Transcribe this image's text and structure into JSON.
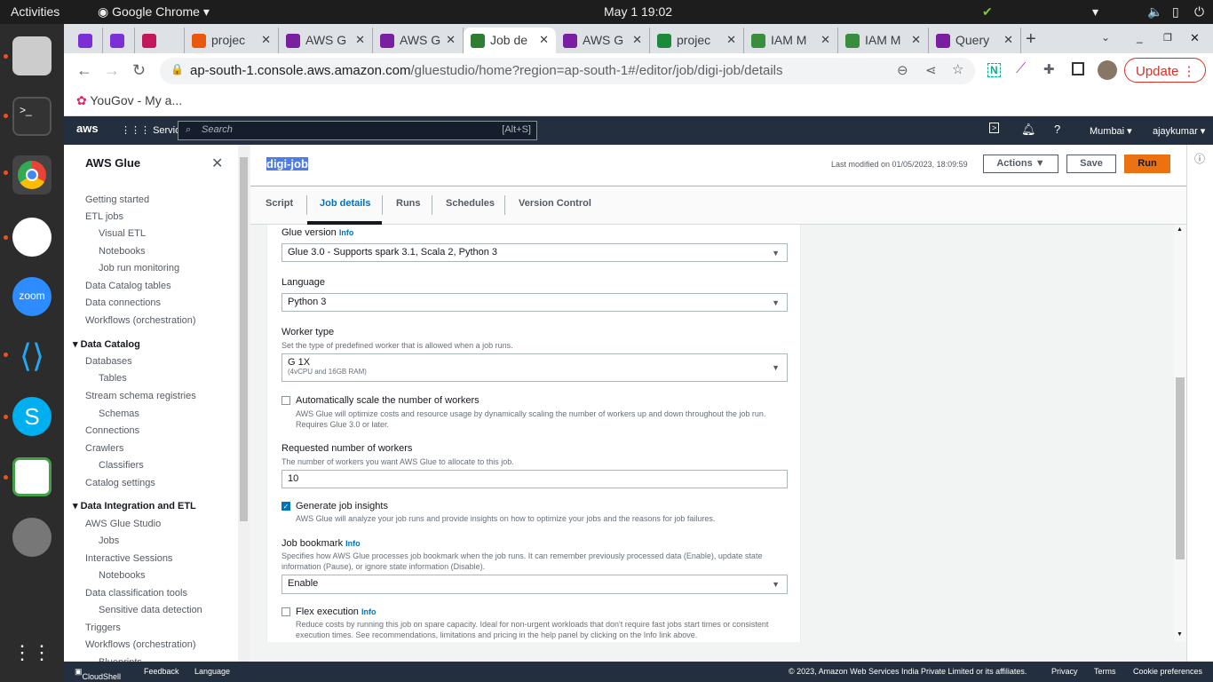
{
  "os": {
    "activities": "Activities",
    "app": "Google Chrome",
    "clock": "May 1  19:02"
  },
  "browser": {
    "tabs": [
      {
        "label": "",
        "color": "#7b2fd6"
      },
      {
        "label": "",
        "color": "#7b2fd6"
      },
      {
        "label": "",
        "color": "#c2185b"
      },
      {
        "label": "projec",
        "color": "#e8590c"
      },
      {
        "label": "AWS G",
        "color": "#7b1fa2"
      },
      {
        "label": "AWS G",
        "color": "#7b1fa2"
      },
      {
        "label": "Job de",
        "color": "#2e7d32"
      },
      {
        "label": "AWS G",
        "color": "#7b1fa2"
      },
      {
        "label": "projec",
        "color": "#1b8a3a"
      },
      {
        "label": "IAM M",
        "color": "#388e3c"
      },
      {
        "label": "IAM M",
        "color": "#388e3c"
      },
      {
        "label": "Query",
        "color": "#7b1fa2"
      }
    ],
    "url_host": "ap-south-1.console.aws.amazon.com",
    "url_path": "/gluestudio/home?region=ap-south-1#/editor/job/digi-job/details",
    "update_label": "Update",
    "bookmark": "YouGov - My a..."
  },
  "aws": {
    "services": "Services",
    "search_placeholder": "Search",
    "search_shortcut": "[Alt+S]",
    "region": "Mumbai ▾",
    "user": "ajaykumar ▾"
  },
  "sidebar": {
    "title": "AWS Glue",
    "items": [
      {
        "label": "Getting started",
        "level": 0
      },
      {
        "label": "ETL jobs",
        "level": 0
      },
      {
        "label": "Visual ETL",
        "level": 1
      },
      {
        "label": "Notebooks",
        "level": 1
      },
      {
        "label": "Job run monitoring",
        "level": 1
      },
      {
        "label": "Data Catalog tables",
        "level": 0
      },
      {
        "label": "Data connections",
        "level": 0
      },
      {
        "label": "Workflows (orchestration)",
        "level": 0
      },
      {
        "label": "▾ Data Catalog",
        "level": -1
      },
      {
        "label": "Databases",
        "level": 0
      },
      {
        "label": "Tables",
        "level": 1
      },
      {
        "label": "Stream schema registries",
        "level": 0
      },
      {
        "label": "Schemas",
        "level": 1
      },
      {
        "label": "Connections",
        "level": 0
      },
      {
        "label": "Crawlers",
        "level": 0
      },
      {
        "label": "Classifiers",
        "level": 1
      },
      {
        "label": "Catalog settings",
        "level": 0
      },
      {
        "label": "▾ Data Integration and ETL",
        "level": -1
      },
      {
        "label": "AWS Glue Studio",
        "level": 0
      },
      {
        "label": "Jobs",
        "level": 1
      },
      {
        "label": "Interactive Sessions",
        "level": 0
      },
      {
        "label": "Notebooks",
        "level": 1
      },
      {
        "label": "Data classification tools",
        "level": 0
      },
      {
        "label": "Sensitive data detection",
        "level": 1
      },
      {
        "label": "Triggers",
        "level": 0
      },
      {
        "label": "Workflows (orchestration)",
        "level": 0
      },
      {
        "label": "Blueprints",
        "level": 1
      }
    ]
  },
  "job": {
    "name": "digi-job",
    "last_modified": "Last modified on 01/05/2023, 18:09:59",
    "actions": "Actions ▼",
    "save": "Save",
    "run": "Run",
    "tabs": [
      "Script",
      "Job details",
      "Runs",
      "Schedules",
      "Version Control"
    ],
    "active_tab": "Job details"
  },
  "form": {
    "info": "Info",
    "glue_version": {
      "label": "Glue version",
      "value": "Glue 3.0 - Supports spark 3.1, Scala 2, Python 3"
    },
    "language": {
      "label": "Language",
      "value": "Python 3"
    },
    "worker_type": {
      "label": "Worker type",
      "desc": "Set the type of predefined worker that is allowed when a job runs.",
      "value": "G 1X",
      "sub": "(4vCPU and 16GB RAM)"
    },
    "autoscale": {
      "label": "Automatically scale the number of workers",
      "checked": false,
      "desc": "AWS Glue will optimize costs and resource usage by dynamically scaling the number of workers up and down throughout the job run. Requires Glue 3.0 or later."
    },
    "workers": {
      "label": "Requested number of workers",
      "desc": "The number of workers you want AWS Glue to allocate to this job.",
      "value": "10"
    },
    "insights": {
      "label": "Generate job insights",
      "checked": true,
      "desc": "AWS Glue will analyze your job runs and provide insights on how to optimize your jobs and the reasons for job failures."
    },
    "bookmark": {
      "label": "Job bookmark",
      "desc": "Specifies how AWS Glue processes job bookmark when the job runs. It can remember previously processed data (Enable), update state information (Pause), or ignore state information (Disable).",
      "value": "Enable"
    },
    "flex": {
      "label": "Flex execution",
      "checked": false,
      "desc": "Reduce costs by running this job on spare capacity. Ideal for non-urgent workloads that don't require fast jobs start times or consistent execution times. See recommendations, limitations and pricing in the help panel by clicking on the Info link above."
    }
  },
  "footer": {
    "cloudshell": "CloudShell",
    "feedback": "Feedback",
    "language": "Language",
    "copyright": "© 2023, Amazon Web Services India Private Limited or its affiliates.",
    "privacy": "Privacy",
    "terms": "Terms",
    "cookies": "Cookie preferences"
  }
}
